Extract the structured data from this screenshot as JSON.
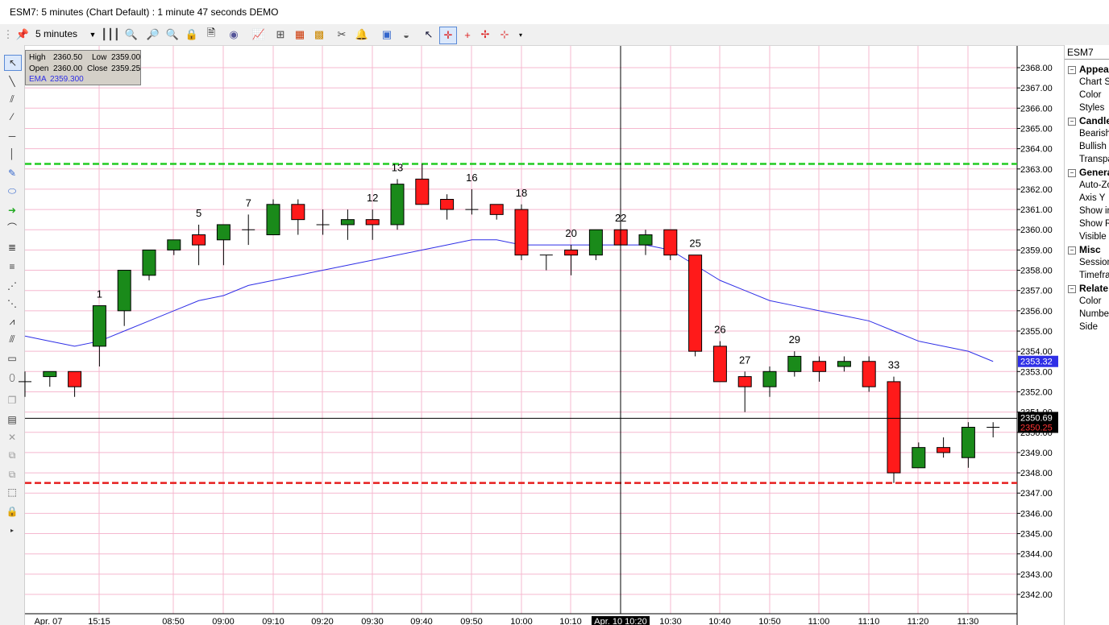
{
  "window": {
    "title": "ESM7: 5 minutes (Chart Default) : 1 minute 47 seconds DEMO"
  },
  "toolbar": {
    "interval": "5 minutes"
  },
  "databox": {
    "high_label": "High",
    "high": "2360.50",
    "low_label": "Low",
    "low": "2359.00",
    "open_label": "Open",
    "open": "2360.00",
    "close_label": "Close",
    "close": "2359.25",
    "ema_label": "EMA",
    "ema": "2359.300"
  },
  "properties": {
    "symbol": "ESM7",
    "sections": [
      {
        "title": "Appear",
        "items": [
          "Chart St",
          "Color",
          "Styles"
        ]
      },
      {
        "title": "Candle",
        "items": [
          "Bearish",
          "Bullish",
          "Transpa"
        ]
      },
      {
        "title": "Genera",
        "items": [
          "Auto-Zo",
          "Axis Y",
          "Show in",
          "Show R",
          "Visible"
        ]
      },
      {
        "title": "Misc",
        "items": [
          "Session",
          "Timefran"
        ]
      },
      {
        "title": "Relate",
        "items": [
          "Color",
          "Number",
          "Side"
        ]
      }
    ]
  },
  "colors": {
    "bull": "#1a8a1a",
    "bear": "#ff1a1a",
    "ema": "#2f2fe6",
    "grid": "#f5b8cf",
    "resistance": "#22cc22",
    "support": "#e61e1e"
  },
  "chart_data": {
    "type": "candlestick",
    "y_ticks": [
      "2368.00",
      "2367.00",
      "2366.00",
      "2365.00",
      "2364.00",
      "2363.00",
      "2362.00",
      "2361.00",
      "2360.00",
      "2359.00",
      "2358.00",
      "2357.00",
      "2356.00",
      "2355.00",
      "2354.00",
      "2353.00",
      "2352.00",
      "2351.00",
      "2350.00",
      "2349.00",
      "2348.00",
      "2347.00",
      "2346.00",
      "2345.00",
      "2344.00",
      "2343.00",
      "2342.00"
    ],
    "x_ticks": [
      "Apr. 07",
      "15:15",
      "08:50",
      "09:00",
      "09:10",
      "09:20",
      "09:30",
      "09:40",
      "09:50",
      "10:00",
      "10:10",
      "Apr. 10 10:20",
      "10:30",
      "10:40",
      "10:50",
      "11:00",
      "11:10",
      "11:20",
      "11:30"
    ],
    "candles": [
      {
        "o": 2352.5,
        "h": 2353.0,
        "l": 2351.75,
        "c": 2352.5
      },
      {
        "o": 2352.75,
        "h": 2353.0,
        "l": 2352.25,
        "c": 2353.0
      },
      {
        "o": 2353.0,
        "h": 2353.0,
        "l": 2351.75,
        "c": 2352.25
      },
      {
        "o": 2354.25,
        "h": 2356.25,
        "l": 2353.25,
        "c": 2356.25
      },
      {
        "o": 2356.0,
        "h": 2358.0,
        "l": 2355.25,
        "c": 2358.0
      },
      {
        "o": 2357.75,
        "h": 2359.0,
        "l": 2357.5,
        "c": 2359.0
      },
      {
        "o": 2359.0,
        "h": 2359.5,
        "l": 2358.75,
        "c": 2359.5
      },
      {
        "o": 2359.75,
        "h": 2360.25,
        "l": 2358.25,
        "c": 2359.25
      },
      {
        "o": 2359.5,
        "h": 2360.25,
        "l": 2358.25,
        "c": 2360.25
      },
      {
        "o": 2360.0,
        "h": 2360.75,
        "l": 2359.25,
        "c": 2360.0
      },
      {
        "o": 2359.75,
        "h": 2361.5,
        "l": 2359.75,
        "c": 2361.25
      },
      {
        "o": 2361.25,
        "h": 2361.5,
        "l": 2359.75,
        "c": 2360.5
      },
      {
        "o": 2360.25,
        "h": 2361.0,
        "l": 2359.75,
        "c": 2360.25
      },
      {
        "o": 2360.25,
        "h": 2361.0,
        "l": 2359.5,
        "c": 2360.5
      },
      {
        "o": 2360.5,
        "h": 2361.0,
        "l": 2359.5,
        "c": 2360.25
      },
      {
        "o": 2360.25,
        "h": 2362.5,
        "l": 2360.0,
        "c": 2362.25
      },
      {
        "o": 2362.5,
        "h": 2363.25,
        "l": 2361.25,
        "c": 2361.25
      },
      {
        "o": 2361.5,
        "h": 2361.75,
        "l": 2360.5,
        "c": 2361.0
      },
      {
        "o": 2361.0,
        "h": 2362.0,
        "l": 2360.75,
        "c": 2361.0
      },
      {
        "o": 2361.25,
        "h": 2361.25,
        "l": 2360.5,
        "c": 2360.75
      },
      {
        "o": 2361.0,
        "h": 2361.25,
        "l": 2358.5,
        "c": 2358.75
      },
      {
        "o": 2358.75,
        "h": 2358.75,
        "l": 2358.0,
        "c": 2358.75
      },
      {
        "o": 2359.0,
        "h": 2359.25,
        "l": 2357.75,
        "c": 2358.75
      },
      {
        "o": 2358.75,
        "h": 2360.0,
        "l": 2358.5,
        "c": 2360.0
      },
      {
        "o": 2360.0,
        "h": 2360.0,
        "l": 2359.25,
        "c": 2359.25
      },
      {
        "o": 2359.25,
        "h": 2360.0,
        "l": 2358.75,
        "c": 2359.75
      },
      {
        "o": 2360.0,
        "h": 2360.0,
        "l": 2358.5,
        "c": 2358.75
      },
      {
        "o": 2358.75,
        "h": 2358.75,
        "l": 2353.75,
        "c": 2354.0
      },
      {
        "o": 2354.25,
        "h": 2354.5,
        "l": 2352.5,
        "c": 2352.5
      },
      {
        "o": 2352.75,
        "h": 2353.0,
        "l": 2351.0,
        "c": 2352.25
      },
      {
        "o": 2352.25,
        "h": 2353.25,
        "l": 2351.75,
        "c": 2353.0
      },
      {
        "o": 2353.0,
        "h": 2354.0,
        "l": 2352.75,
        "c": 2353.75
      },
      {
        "o": 2353.5,
        "h": 2353.75,
        "l": 2352.5,
        "c": 2353.0
      },
      {
        "o": 2353.25,
        "h": 2353.75,
        "l": 2353.0,
        "c": 2353.5
      },
      {
        "o": 2353.5,
        "h": 2353.75,
        "l": 2352.0,
        "c": 2352.25
      },
      {
        "o": 2352.5,
        "h": 2352.75,
        "l": 2347.5,
        "c": 2348.0
      },
      {
        "o": 2348.25,
        "h": 2349.5,
        "l": 2348.25,
        "c": 2349.25
      },
      {
        "o": 2349.25,
        "h": 2349.75,
        "l": 2348.75,
        "c": 2349.0
      },
      {
        "o": 2348.75,
        "h": 2350.5,
        "l": 2348.25,
        "c": 2350.25
      },
      {
        "o": 2350.25,
        "h": 2350.5,
        "l": 2349.75,
        "c": 2350.25
      }
    ],
    "ema": [
      2354.75,
      2354.5,
      2354.25,
      2354.5,
      2355.0,
      2355.5,
      2356.0,
      2356.5,
      2356.75,
      2357.25,
      2357.5,
      2357.75,
      2358.0,
      2358.25,
      2358.5,
      2358.75,
      2359.0,
      2359.25,
      2359.5,
      2359.5,
      2359.25,
      2359.25,
      2359.25,
      2359.25,
      2359.25,
      2359.25,
      2359.0,
      2358.25,
      2357.5,
      2357.0,
      2356.5,
      2356.25,
      2356.0,
      2355.75,
      2355.5,
      2355.0,
      2354.5,
      2354.25,
      2354.0,
      2353.5
    ],
    "count_labels": [
      {
        "i": 3,
        "text": "1"
      },
      {
        "i": 7,
        "text": "5"
      },
      {
        "i": 9,
        "text": "7"
      },
      {
        "i": 14,
        "text": "12"
      },
      {
        "i": 15,
        "text": "13"
      },
      {
        "i": 18,
        "text": "16"
      },
      {
        "i": 20,
        "text": "18"
      },
      {
        "i": 22,
        "text": "20"
      },
      {
        "i": 24,
        "text": "22"
      },
      {
        "i": 27,
        "text": "25"
      },
      {
        "i": 28,
        "text": "26"
      },
      {
        "i": 29,
        "text": "27"
      },
      {
        "i": 31,
        "text": "29"
      },
      {
        "i": 35,
        "text": "33"
      }
    ],
    "levels": [
      {
        "price": 2363.25,
        "kind": "resistance"
      },
      {
        "price": 2347.5,
        "kind": "support"
      }
    ],
    "crosshair": {
      "price": 2350.69,
      "label": "2350.69"
    },
    "ema_label": "2353.32",
    "last_price_label": "2350.25",
    "ylim": [
      2341.25,
      2368.75
    ]
  }
}
